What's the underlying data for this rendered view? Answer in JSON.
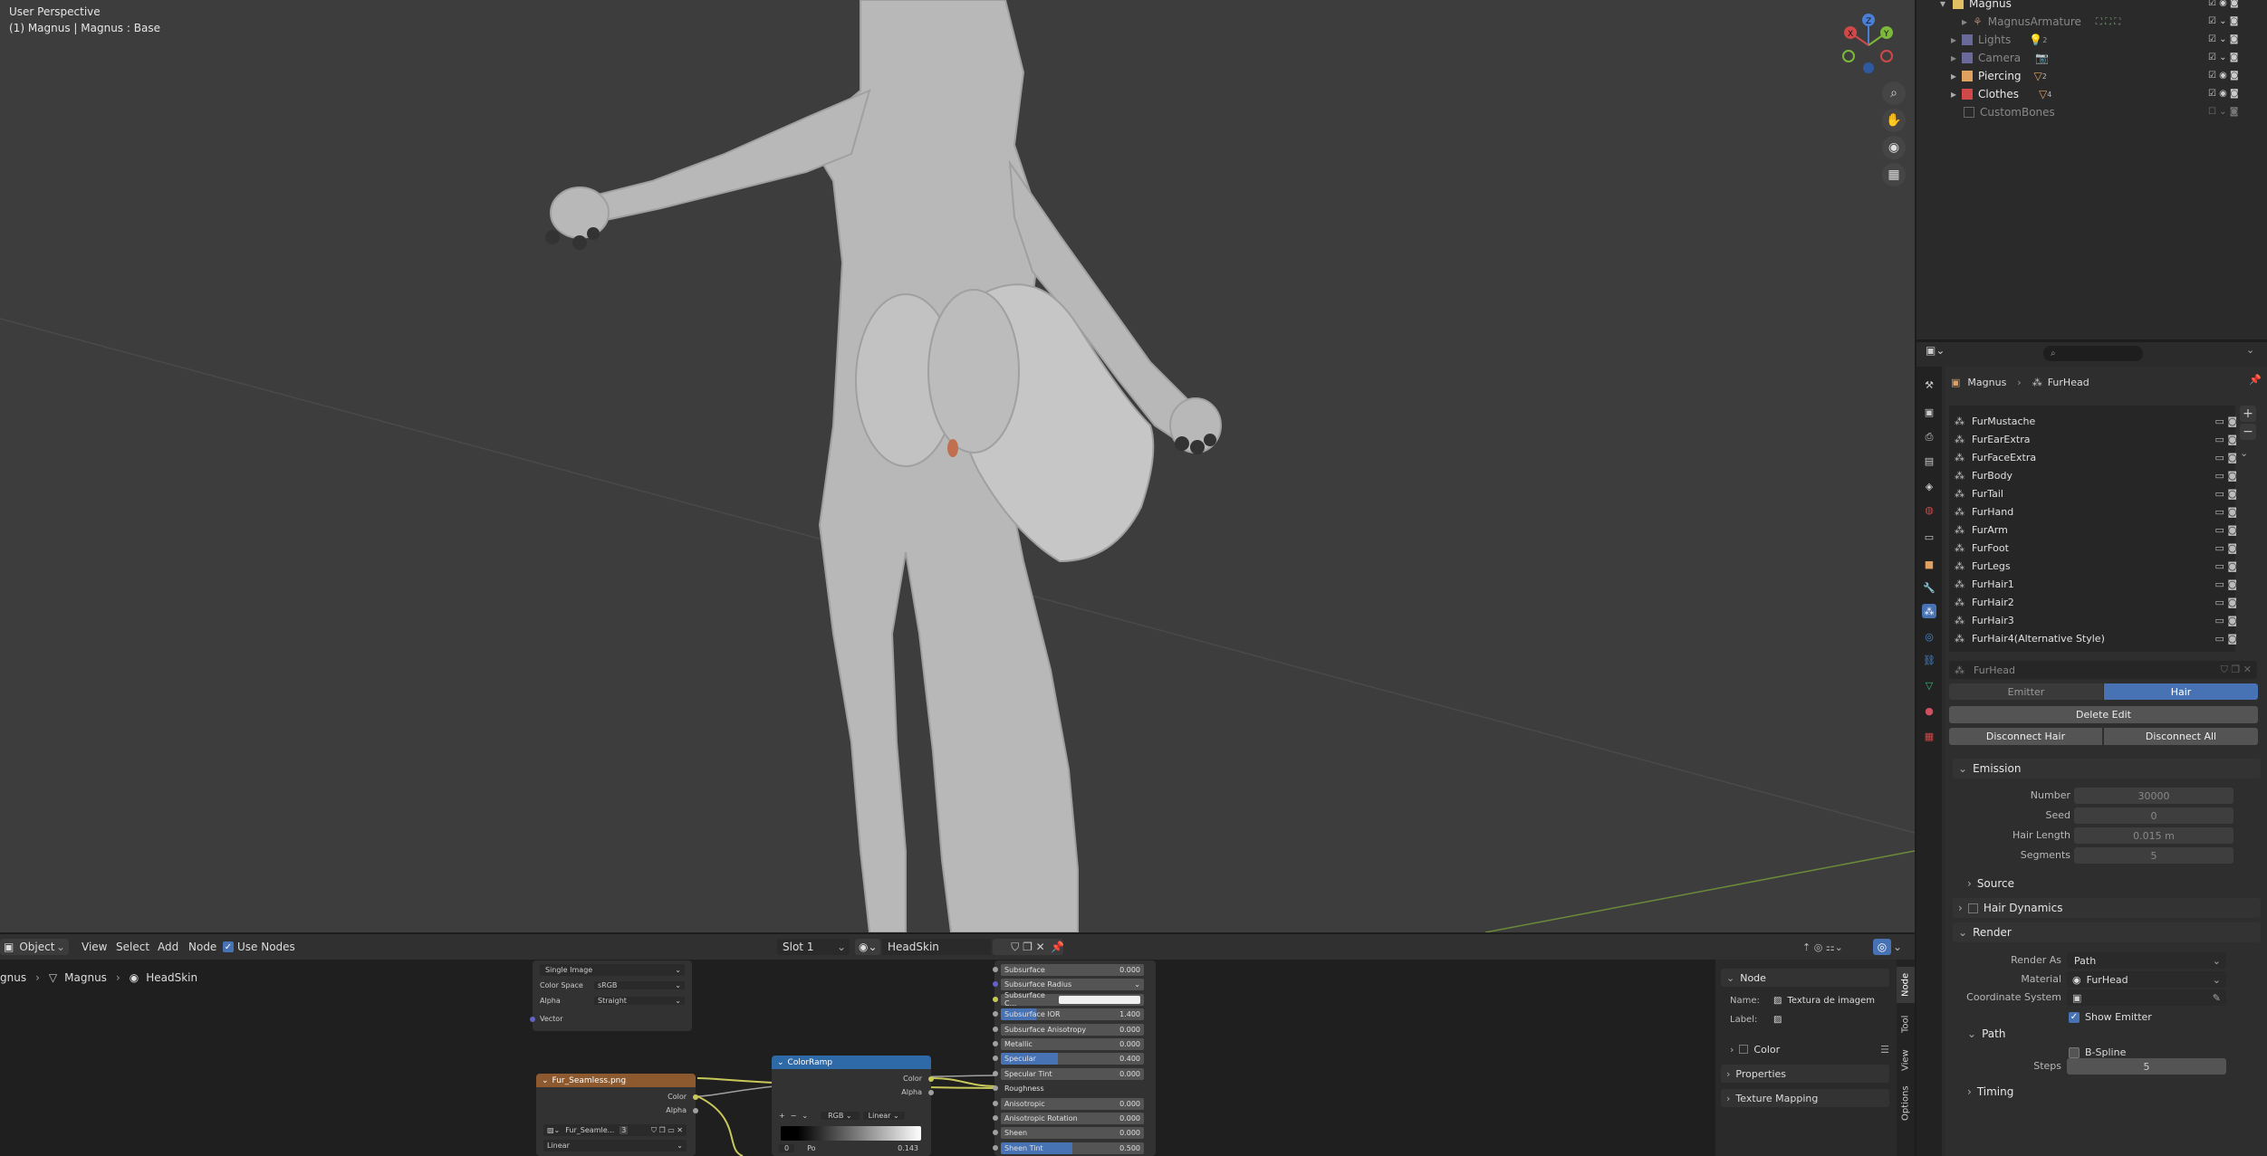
{
  "viewport": {
    "info_line1": "User Perspective",
    "info_line2": "(1) Magnus | Magnus : Base",
    "gizmo": {
      "x": "X",
      "y": "Y",
      "z": "Z"
    }
  },
  "outliner": {
    "rows": [
      {
        "label": "Magnus",
        "color": "#e0c060"
      },
      {
        "label": "MagnusArmature",
        "color": "#a08070",
        "dim": true
      },
      {
        "label": "Lights",
        "color": "#9a8a70",
        "dim": true,
        "badge": "2"
      },
      {
        "label": "Camera",
        "color": "#9a8a70",
        "dim": true
      },
      {
        "label": "Piercing",
        "color": "#e0a060",
        "badge": "2"
      },
      {
        "label": "Clothes",
        "color": "#e0a060",
        "badge": "4"
      },
      {
        "label": "CustomBones",
        "color": "#888888",
        "dim": true
      }
    ]
  },
  "properties": {
    "search_placeholder": "",
    "breadcrumb": {
      "object": "Magnus",
      "system": "FurHead"
    },
    "particle_list": [
      "FurMustache",
      "FurEarExtra",
      "FurFaceExtra",
      "FurBody",
      "FurTail",
      "FurHand",
      "FurArm",
      "FurFoot",
      "FurLegs",
      "FurHair1",
      "FurHair2",
      "FurHair3",
      "FurHair4(Alternative Style)"
    ],
    "settings_name": "FurHead",
    "type_tabs": {
      "emitter": "Emitter",
      "hair": "Hair"
    },
    "delete_edit": "Delete Edit",
    "disconnect_hair": "Disconnect Hair",
    "disconnect_all": "Disconnect All",
    "emission": {
      "title": "Emission",
      "number_label": "Number",
      "number": "30000",
      "seed_label": "Seed",
      "seed": "0",
      "hair_length_label": "Hair Length",
      "hair_length": "0.015 m",
      "segments_label": "Segments",
      "segments": "5"
    },
    "source": "Source",
    "hair_dynamics": "Hair Dynamics",
    "render": {
      "title": "Render",
      "render_as_label": "Render As",
      "render_as": "Path",
      "material_label": "Material",
      "material": "FurHead",
      "coordinate_system_label": "Coordinate System",
      "show_emitter": "Show Emitter"
    },
    "path": {
      "title": "Path",
      "bspline": "B-Spline",
      "steps_label": "Steps",
      "steps": "5"
    },
    "timing": "Timing"
  },
  "node_editor": {
    "header": {
      "mode": "Object",
      "menu": [
        "View",
        "Select",
        "Add",
        "Node"
      ],
      "use_nodes": "Use Nodes",
      "slot": "Slot 1",
      "material": "HeadSkin"
    },
    "breadcrumb": {
      "a": "gnus",
      "b": "Magnus",
      "c": "HeadSkin"
    },
    "image_node": {
      "source": "Single Image",
      "color_space_label": "Color Space",
      "color_space": "sRGB",
      "alpha_label": "Alpha",
      "alpha": "Straight",
      "vector": "Vector"
    },
    "fur_node": {
      "title": "Fur_Seamless.png",
      "color": "Color",
      "alpha": "Alpha",
      "image_name": "Fur_Seamle...",
      "users": "3",
      "interpolation": "Linear"
    },
    "colorramp_node": {
      "title": "ColorRamp",
      "color": "Color",
      "alpha": "Alpha",
      "mode": "RGB",
      "interp": "Linear",
      "pos": "0",
      "pos_label": "Po",
      "pos_val": "0.143"
    },
    "bsdf_rows": [
      {
        "label": "Subsurface",
        "value": "0.000"
      },
      {
        "label": "Subsurface Radius",
        "value": ""
      },
      {
        "label": "Subsurface C...",
        "value": ""
      },
      {
        "label": "Subsurface IOR",
        "value": "1.400"
      },
      {
        "label": "Subsurface Anisotropy",
        "value": "0.000"
      },
      {
        "label": "Metallic",
        "value": "0.000"
      },
      {
        "label": "Specular",
        "value": "0.400"
      },
      {
        "label": "Specular Tint",
        "value": "0.000"
      },
      {
        "label": "Roughness",
        "value": ""
      },
      {
        "label": "Anisotropic",
        "value": "0.000"
      },
      {
        "label": "Anisotropic Rotation",
        "value": "0.000"
      },
      {
        "label": "Sheen",
        "value": "0.000"
      },
      {
        "label": "Sheen Tint",
        "value": "0.500"
      }
    ],
    "sidebar": {
      "section": "Node",
      "name_label": "Name:",
      "name": "Textura de imagem",
      "label_label": "Label:",
      "color": "Color",
      "properties": "Properties",
      "texture_mapping": "Texture Mapping",
      "tabs": [
        "Node",
        "Tool",
        "View",
        "Options"
      ]
    }
  }
}
